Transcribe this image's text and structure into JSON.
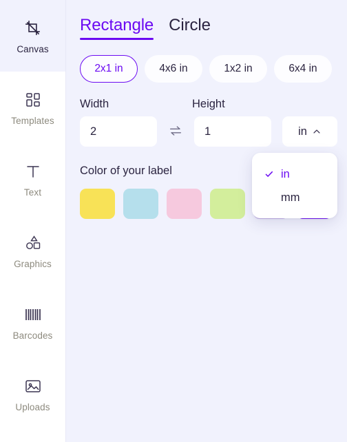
{
  "sidebar": {
    "items": [
      {
        "label": "Canvas",
        "icon": "crop-icon",
        "active": true
      },
      {
        "label": "Templates",
        "icon": "grid-icon",
        "active": false
      },
      {
        "label": "Text",
        "icon": "text-t-icon",
        "active": false
      },
      {
        "label": "Graphics",
        "icon": "shapes-icon",
        "active": false
      },
      {
        "label": "Barcodes",
        "icon": "barcode-icon",
        "active": false
      },
      {
        "label": "Uploads",
        "icon": "image-upload-icon",
        "active": false
      }
    ]
  },
  "tabs": [
    {
      "label": "Rectangle",
      "active": true
    },
    {
      "label": "Circle",
      "active": false
    }
  ],
  "presets": [
    {
      "label": "2x1 in",
      "selected": true
    },
    {
      "label": "4x6 in",
      "selected": false
    },
    {
      "label": "1x2 in",
      "selected": false
    },
    {
      "label": "6x4 in",
      "selected": false
    }
  ],
  "dimensions": {
    "width_label": "Width",
    "height_label": "Height",
    "width_value": "2",
    "height_value": "1",
    "width_placeholder": "Width",
    "height_placeholder": "Height",
    "swap_icon": "swap-arrows-icon",
    "unit_value": "in",
    "unit_chevron": "chevron-up-icon"
  },
  "unit_dropdown": {
    "open": true,
    "options": [
      {
        "label": "in",
        "selected": true
      },
      {
        "label": "mm",
        "selected": false
      }
    ]
  },
  "colors": {
    "title": "Color of your label",
    "swatches": [
      {
        "name": "yellow",
        "hex": "#f8e257",
        "selected": false
      },
      {
        "name": "light-blue",
        "hex": "#b5dfec",
        "selected": false
      },
      {
        "name": "pink",
        "hex": "#f6c9de",
        "selected": false
      },
      {
        "name": "green",
        "hex": "#d3ee9c",
        "selected": false
      },
      {
        "name": "purple",
        "hex": "#c4b4e6",
        "selected": false
      },
      {
        "name": "white",
        "hex": "#ffffff",
        "selected": true
      }
    ]
  },
  "theme": {
    "accent": "#6b0af2",
    "background": "#f1f2fd",
    "surface": "#ffffff"
  }
}
